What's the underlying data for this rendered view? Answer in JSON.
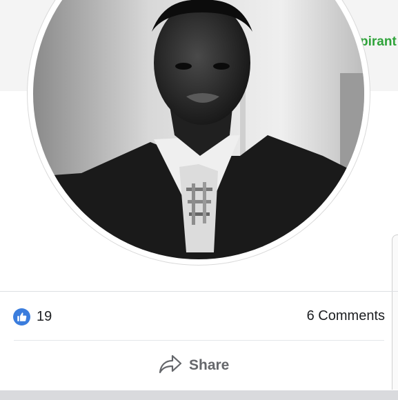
{
  "header": {
    "cover_text": "pirant"
  },
  "post": {
    "reactions": {
      "icon": "thumbs-up-icon",
      "count": "19",
      "color": "#3b7ddd"
    },
    "comments_label": "6 Comments",
    "actions": {
      "share_label": "Share",
      "share_icon": "share-arrow-icon"
    }
  },
  "colors": {
    "accent_green": "#2fa33a",
    "like_blue": "#3b7ddd",
    "muted_text": "#65676b"
  }
}
